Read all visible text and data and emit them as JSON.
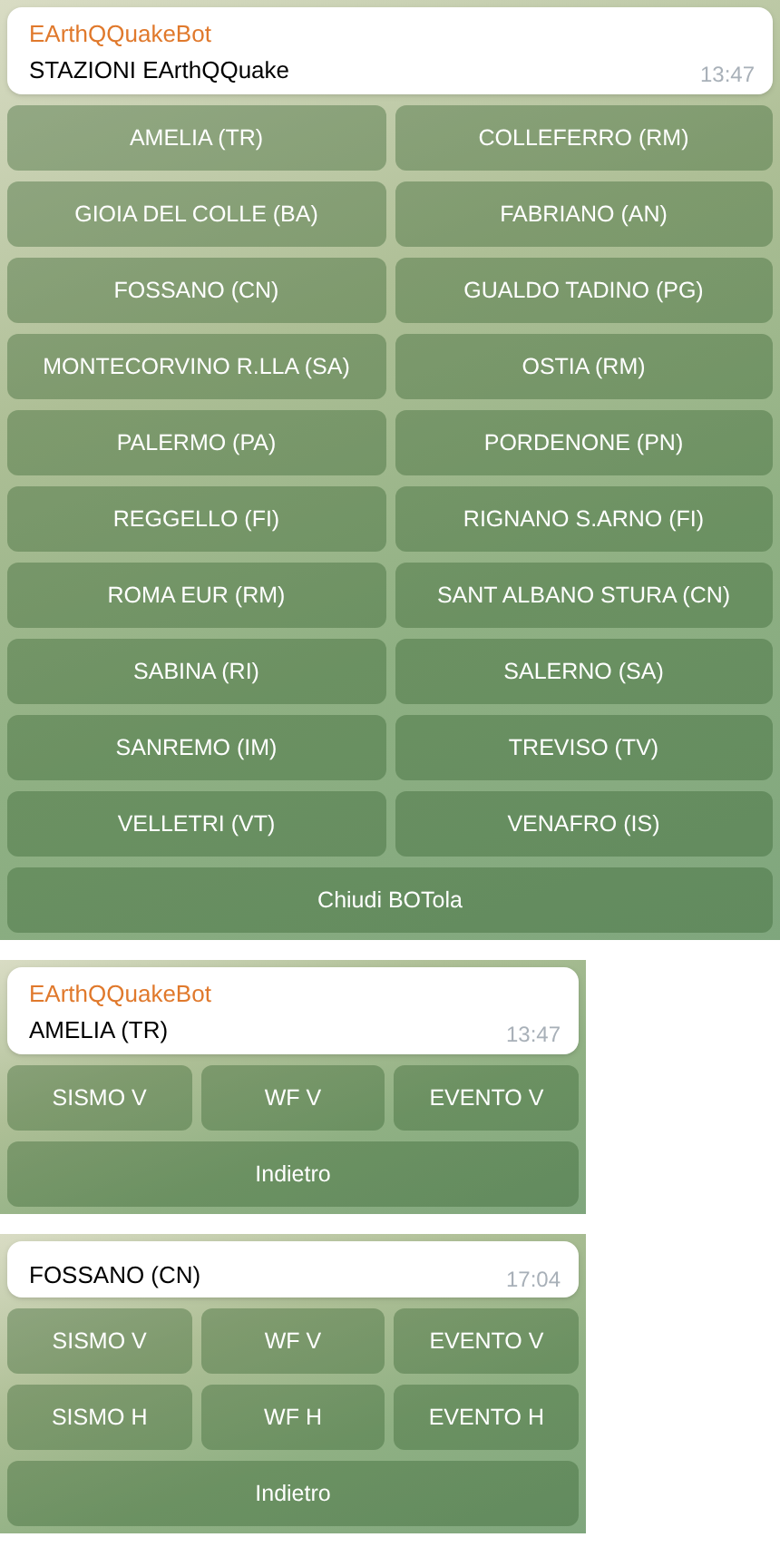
{
  "screens": [
    {
      "sender": "EArthQQuakeBot",
      "message": "STAZIONI EArthQQuake",
      "time": "13:47",
      "keyboard": [
        [
          "AMELIA (TR)",
          "COLLEFERRO (RM)"
        ],
        [
          "GIOIA DEL COLLE (BA)",
          "FABRIANO (AN)"
        ],
        [
          "FOSSANO (CN)",
          "GUALDO TADINO (PG)"
        ],
        [
          "MONTECORVINO R.LLA (SA)",
          "OSTIA (RM)"
        ],
        [
          "PALERMO (PA)",
          "PORDENONE (PN)"
        ],
        [
          "REGGELLO (FI)",
          "RIGNANO S.ARNO (FI)"
        ],
        [
          "ROMA EUR (RM)",
          "SANT ALBANO STURA (CN)"
        ],
        [
          "SABINA (RI)",
          "SALERNO (SA)"
        ],
        [
          "SANREMO (IM)",
          "TREVISO (TV)"
        ],
        [
          "VELLETRI (VT)",
          "VENAFRO (IS)"
        ],
        [
          "Chiudi BOTola"
        ]
      ]
    },
    {
      "sender": "EArthQQuakeBot",
      "message": "AMELIA (TR)",
      "time": "13:47",
      "keyboard": [
        [
          "SISMO V",
          "WF V",
          "EVENTO V"
        ],
        [
          "Indietro"
        ]
      ]
    },
    {
      "message": "FOSSANO (CN)",
      "time": "17:04",
      "keyboard": [
        [
          "SISMO V",
          "WF V",
          "EVENTO V"
        ],
        [
          "SISMO H",
          "WF H",
          "EVENTO H"
        ],
        [
          "Indietro"
        ]
      ]
    }
  ]
}
